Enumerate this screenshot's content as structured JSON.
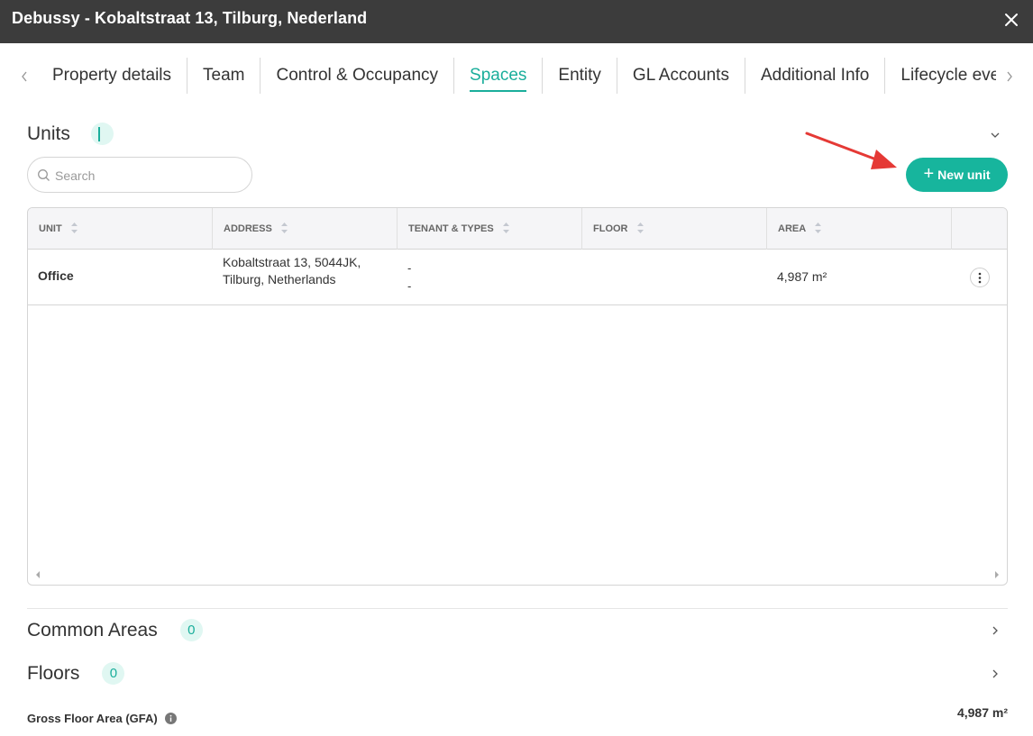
{
  "window": {
    "title": "Debussy - Kobaltstraat 13, Tilburg, Nederland"
  },
  "tabs": [
    {
      "label": "Property details"
    },
    {
      "label": "Team"
    },
    {
      "label": "Control & Occupancy"
    },
    {
      "label": "Spaces",
      "active": true
    },
    {
      "label": "Entity"
    },
    {
      "label": "GL Accounts"
    },
    {
      "label": "Additional Info"
    },
    {
      "label": "Lifecycle events"
    }
  ],
  "units": {
    "title": "Units",
    "count": "1",
    "search_placeholder": "Search",
    "new_button_label": "New unit",
    "columns": [
      "UNIT",
      "ADDRESS",
      "TENANT & TYPES",
      "FLOOR",
      "AREA"
    ],
    "rows": [
      {
        "unit": "Office",
        "address": "Kobaltstraat 13, 5044JK, Tilburg, Netherlands",
        "tenant": "-",
        "types": "-",
        "floor": "",
        "area": "4,987 m²"
      }
    ]
  },
  "common_areas": {
    "title": "Common Areas",
    "count": "0"
  },
  "floors": {
    "title": "Floors",
    "count": "0"
  },
  "gfa": {
    "label": "Gross Floor Area (GFA)",
    "value": "4,987 m²"
  },
  "colors": {
    "accent": "#17b59d",
    "titlebar": "#3c3c3c",
    "arrow": "#e53935",
    "badge_bg": "#e0f7f2"
  }
}
